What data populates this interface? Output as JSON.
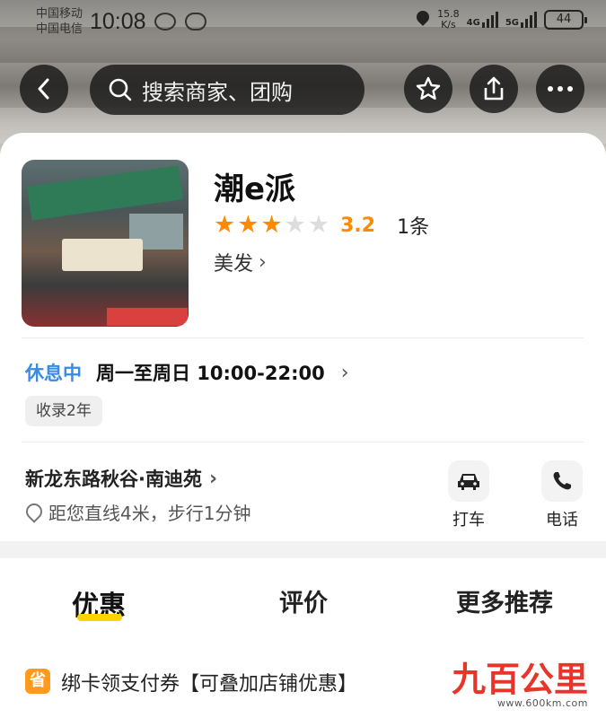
{
  "status_bar": {
    "carrier_1": "中国移动",
    "carrier_2": "中国电信",
    "time": "10:08",
    "speed_value": "15.8",
    "speed_unit": "K/s",
    "net_1": "4G",
    "net_2": "5G",
    "battery": "44"
  },
  "nav": {
    "search_placeholder": "搜索商家、团购",
    "icons": [
      "back-icon",
      "search-icon",
      "star-icon",
      "share-icon",
      "more-icon"
    ]
  },
  "shop": {
    "name": "潮e派",
    "rating_stars": 3,
    "rating_max": 5,
    "score": "3.2",
    "reviews": "1条",
    "category": "美发"
  },
  "hours": {
    "status": "休息中",
    "text": "周一至周日 10:00-22:00"
  },
  "tag": "收录2年",
  "address": {
    "street": "新龙东路秋谷·南迪苑",
    "distance": "距您直线4米，步行1分钟"
  },
  "actions": {
    "taxi_label": "打车",
    "phone_label": "电话"
  },
  "tabs": {
    "discount": "优惠",
    "reviews": "评价",
    "more": "更多推荐"
  },
  "promo": {
    "icon_text": "省",
    "text": "绑卡领支付券【可叠加店铺优惠】"
  },
  "watermark": {
    "main": "九百公里",
    "url": "www.600km.com"
  },
  "colors": {
    "star_active": "#ff8a00",
    "star_inactive": "#dddddd",
    "closed_status": "#3a8be0",
    "tab_indicator": "#ffd300",
    "promo_icon": "#ff9a1f"
  }
}
